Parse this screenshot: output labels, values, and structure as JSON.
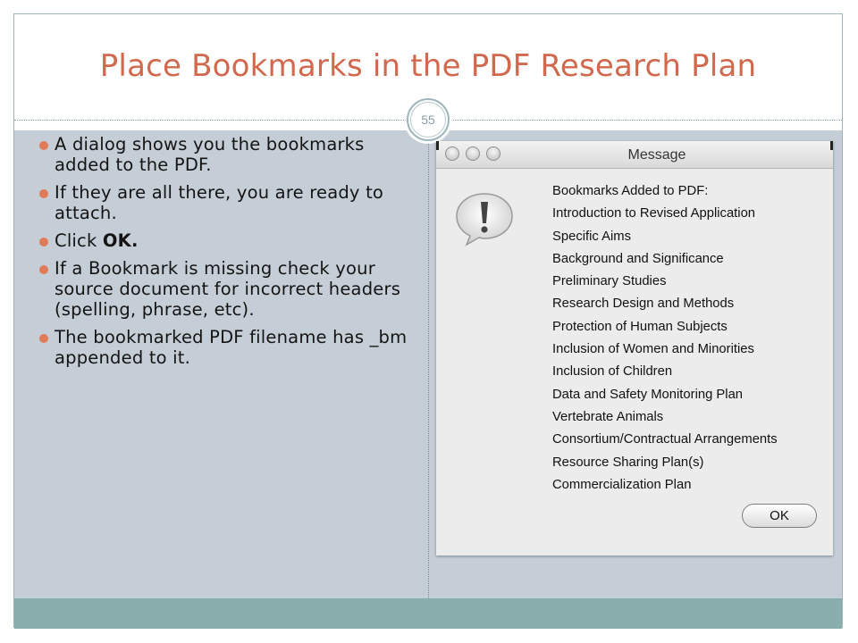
{
  "slide": {
    "title": "Place Bookmarks in the PDF Research Plan",
    "page_number": "55"
  },
  "bullets": [
    {
      "text": "A dialog shows you the bookmarks added to the PDF."
    },
    {
      "text": "If they are all there, you are ready to attach."
    },
    {
      "text_before": "Click ",
      "text_bold": "OK."
    },
    {
      "text": "If a Bookmark is missing check your source document for incorrect headers (spelling, phrase, etc)."
    },
    {
      "text": "The bookmarked PDF filename has _bm appended to it."
    }
  ],
  "dialog": {
    "title": "Message",
    "icon": "exclamation-speech-bubble-icon",
    "lines": [
      "Bookmarks Added to PDF:",
      "Introduction to Revised Application",
      "Specific Aims",
      "Background and Significance",
      "Preliminary Studies",
      "Research Design and Methods",
      "Protection of Human Subjects",
      "Inclusion of Women and Minorities",
      "Inclusion of Children",
      "Data and Safety Monitoring Plan",
      "Vertebrate Animals",
      "Consortium/Contractual Arrangements",
      "Resource Sharing Plan(s)",
      "Commercialization Plan"
    ],
    "ok_label": "OK"
  },
  "colors": {
    "title": "#d2694e",
    "bullet": "#e07a57",
    "content_bg": "#c5ced6",
    "footer": "#8aaeae"
  }
}
